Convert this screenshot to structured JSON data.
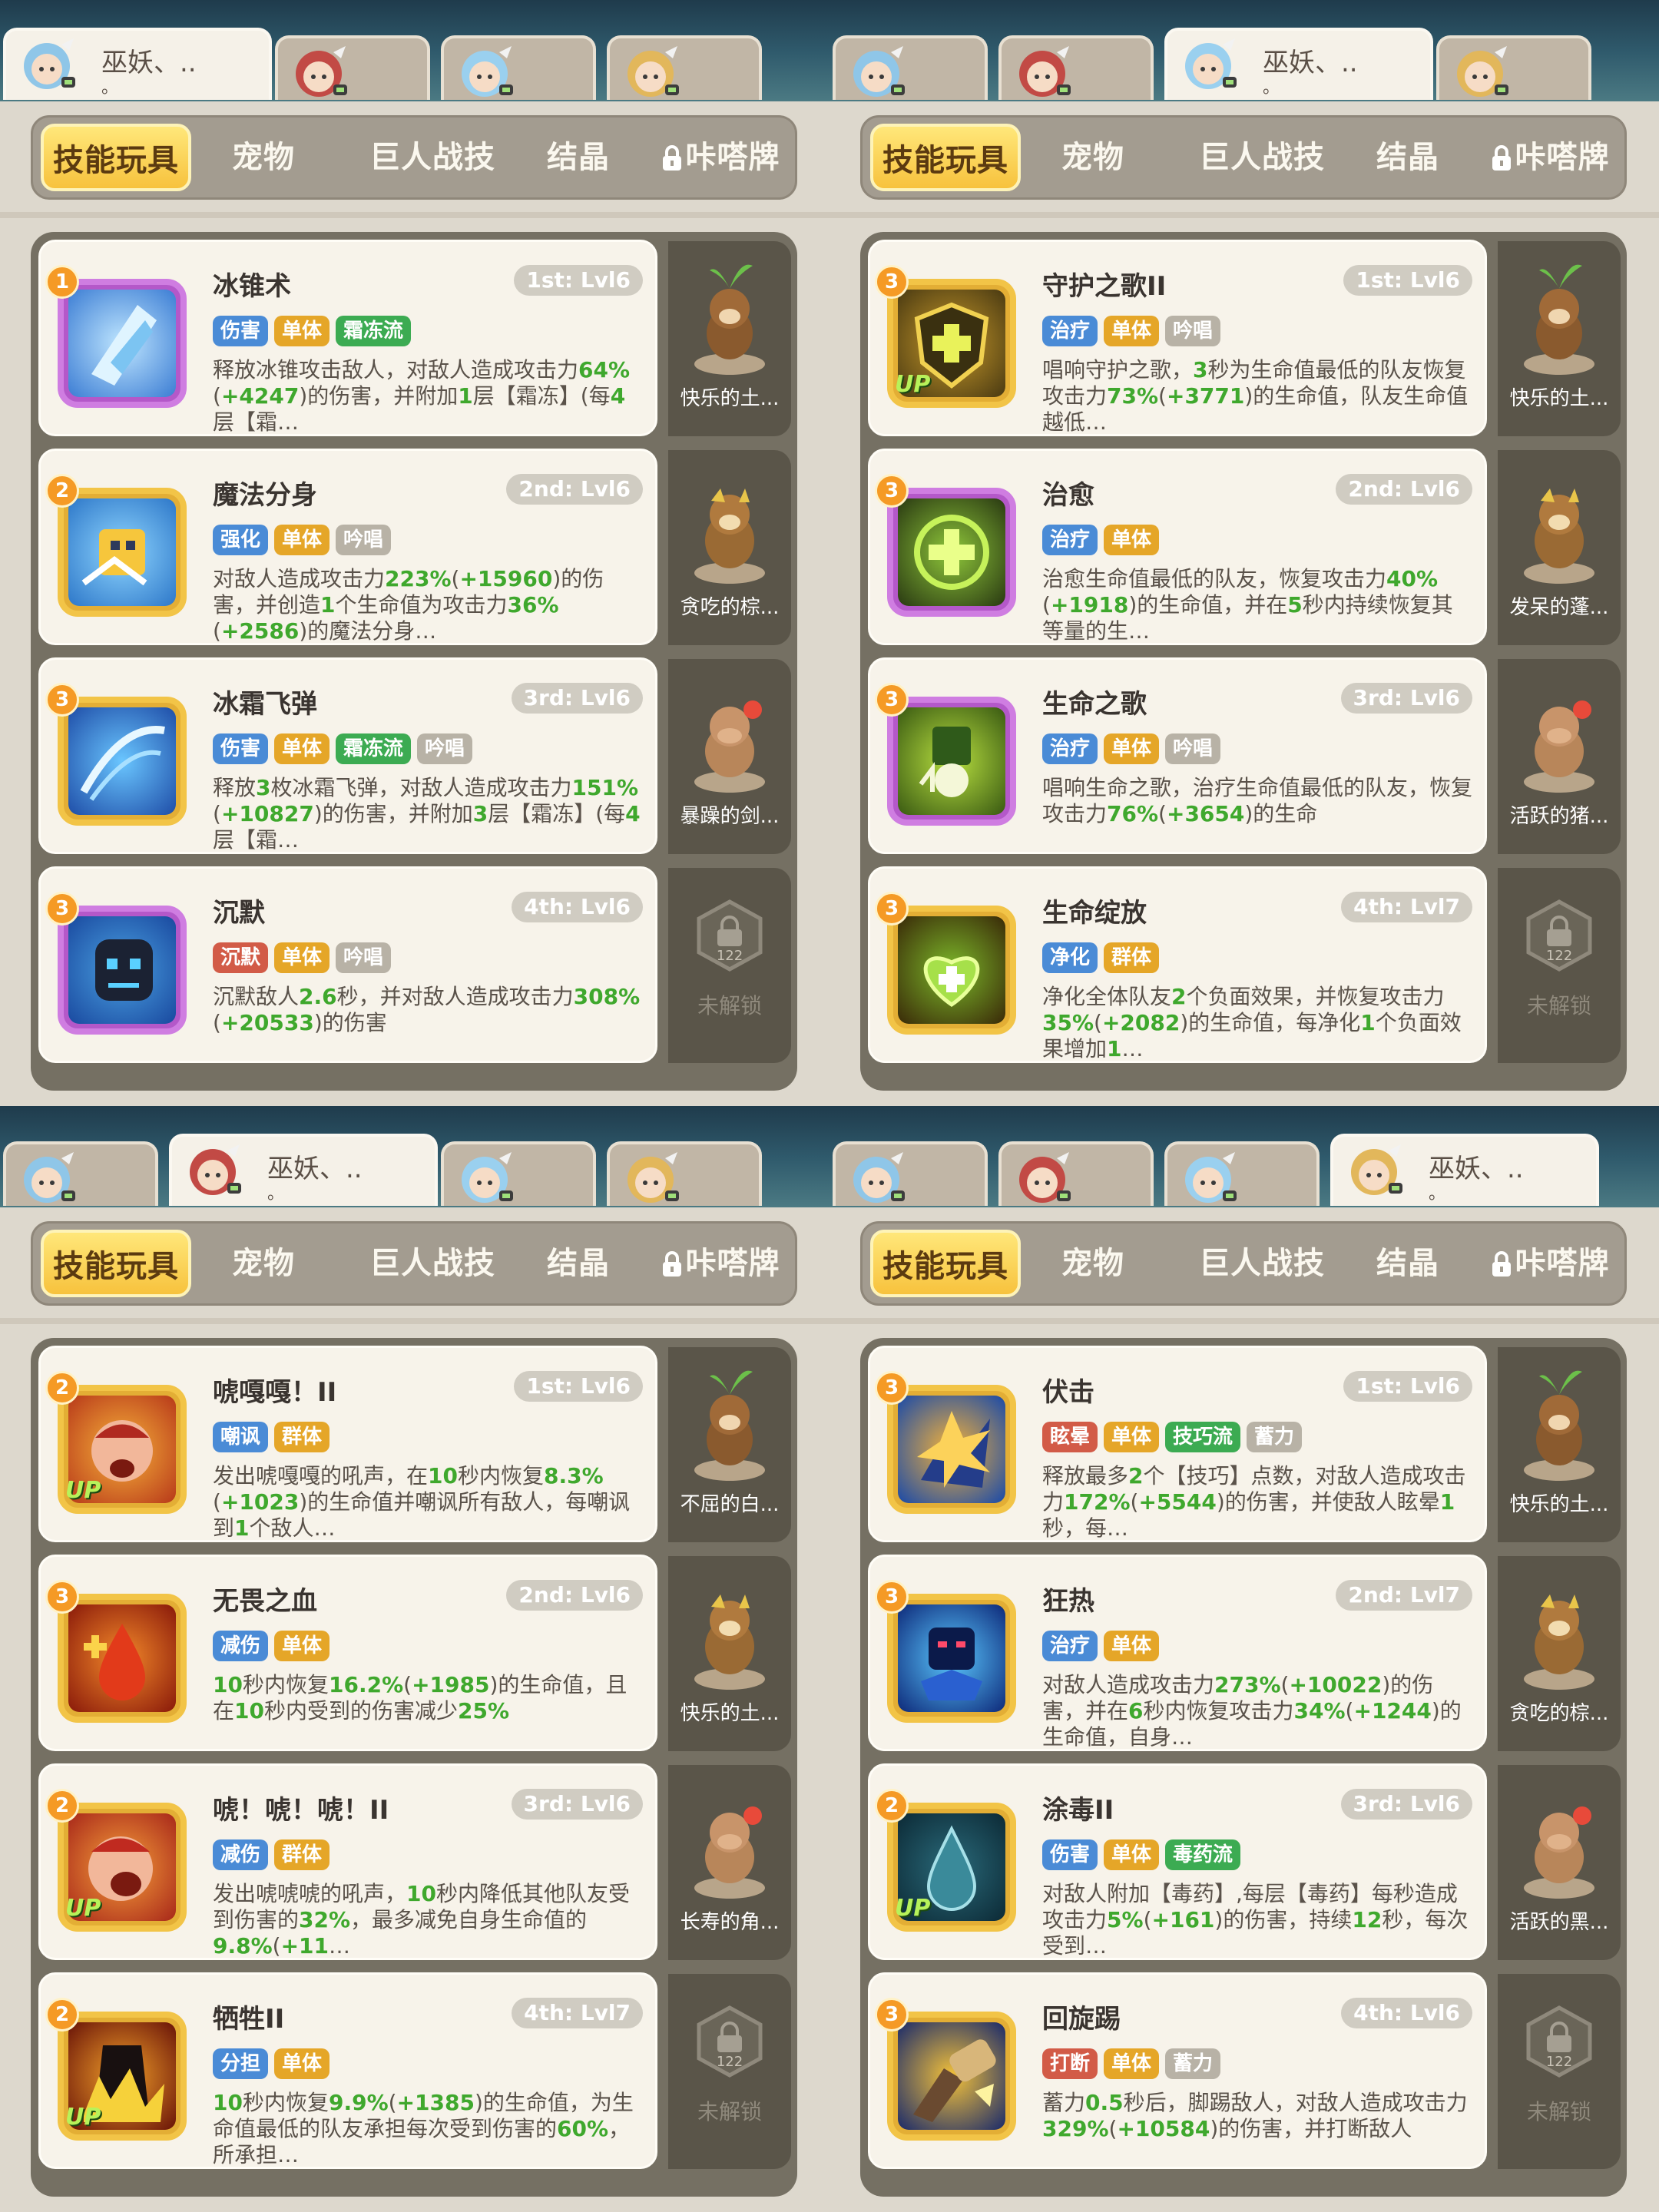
{
  "panels": [
    {
      "selected_char": 0,
      "selected_char_name": "巫妖、..",
      "selected_char_sub": "。",
      "cards": [
        {
          "name": "冰锥术",
          "level": "1st: Lvl6",
          "rank": "1",
          "frame": "purple",
          "icon": "ice-cone-icon",
          "up": false,
          "tags": [
            {
              "text": "伤害",
              "color": "#4a8bd6"
            },
            {
              "text": "单体",
              "color": "#e5a628"
            },
            {
              "text": "霜冻流",
              "color": "#3cab52"
            }
          ],
          "desc": "释放冰锥攻击敌人，对敌人造成攻击力64%(+4247)的伤害，并附加1层【霜冻】(每4层【霜…"
        },
        {
          "name": "魔法分身",
          "level": "2nd: Lvl6",
          "rank": "2",
          "frame": "gold",
          "icon": "magic-clone-icon",
          "up": false,
          "tags": [
            {
              "text": "强化",
              "color": "#4a8bd6"
            },
            {
              "text": "单体",
              "color": "#e5a628"
            },
            {
              "text": "吟唱",
              "color": "#b8b2a6"
            }
          ],
          "desc": "对敌人造成攻击力223%(+15960)的伤害，并创造1个生命值为攻击力36%(+2586)的魔法分身…"
        },
        {
          "name": "冰霜飞弹",
          "level": "3rd: Lvl6",
          "rank": "3",
          "frame": "gold",
          "icon": "frost-missile-icon",
          "up": false,
          "tags": [
            {
              "text": "伤害",
              "color": "#4a8bd6"
            },
            {
              "text": "单体",
              "color": "#e5a628"
            },
            {
              "text": "霜冻流",
              "color": "#3cab52"
            },
            {
              "text": "吟唱",
              "color": "#b8b2a6"
            }
          ],
          "desc": "释放3枚冰霜飞弹，对敌人造成攻击力151%(+10827)的伤害，并附加3层【霜冻】(每4层【霜…"
        },
        {
          "name": "沉默",
          "level": "4th: Lvl6",
          "rank": "3",
          "frame": "purple",
          "icon": "silence-icon",
          "up": false,
          "tags": [
            {
              "text": "沉默",
              "color": "#d25b47"
            },
            {
              "text": "单体",
              "color": "#e5a628"
            },
            {
              "text": "吟唱",
              "color": "#b8b2a6"
            }
          ],
          "desc": "沉默敌人2.6秒，并对敌人造成攻击力308%(+20533)的伤害"
        }
      ],
      "pets": [
        "快乐的土...",
        "贪吃的棕...",
        "暴躁的剑..."
      ]
    },
    {
      "selected_char": 2,
      "selected_char_name": "巫妖、..",
      "selected_char_sub": "。",
      "cards": [
        {
          "name": "守护之歌II",
          "level": "1st: Lvl6",
          "rank": "3",
          "frame": "gold",
          "icon": "guard-song-icon",
          "up": true,
          "tags": [
            {
              "text": "治疗",
              "color": "#4a8bd6"
            },
            {
              "text": "单体",
              "color": "#e5a628"
            },
            {
              "text": "吟唱",
              "color": "#b8b2a6"
            }
          ],
          "desc": "唱响守护之歌，3秒为生命值最低的队友恢复攻击力73%(+3771)的生命值，队友生命值越低…"
        },
        {
          "name": "治愈",
          "level": "2nd: Lvl6",
          "rank": "3",
          "frame": "purple",
          "icon": "heal-icon",
          "up": false,
          "tags": [
            {
              "text": "治疗",
              "color": "#4a8bd6"
            },
            {
              "text": "单体",
              "color": "#e5a628"
            }
          ],
          "desc": "治愈生命值最低的队友，恢复攻击力40%(+1918)的生命值，并在5秒内持续恢复其等量的生…"
        },
        {
          "name": "生命之歌",
          "level": "3rd: Lvl6",
          "rank": "3",
          "frame": "purple",
          "icon": "life-song-icon",
          "up": false,
          "tags": [
            {
              "text": "治疗",
              "color": "#4a8bd6"
            },
            {
              "text": "单体",
              "color": "#e5a628"
            },
            {
              "text": "吟唱",
              "color": "#b8b2a6"
            }
          ],
          "desc": "唱响生命之歌，治疗生命值最低的队友，恢复攻击力76%(+3654)的生命"
        },
        {
          "name": "生命绽放",
          "level": "4th: Lvl7",
          "rank": "3",
          "frame": "gold",
          "icon": "life-bloom-icon",
          "up": false,
          "tags": [
            {
              "text": "净化",
              "color": "#4a8bd6"
            },
            {
              "text": "群体",
              "color": "#e5a628"
            }
          ],
          "desc": "净化全体队友2个负面效果，并恢复攻击力35%(+2082)的生命值，每净化1个负面效果增加1…"
        }
      ],
      "pets": [
        "快乐的土...",
        "发呆的蓬...",
        "活跃的猪..."
      ]
    },
    {
      "selected_char": 1,
      "selected_char_name": "巫妖、..",
      "selected_char_sub": "。",
      "cards": [
        {
          "name": "唬嘎嘎！II",
          "level": "1st: Lvl6",
          "rank": "2",
          "frame": "gold",
          "icon": "roar-icon",
          "up": true,
          "tags": [
            {
              "text": "嘲讽",
              "color": "#4a8bd6"
            },
            {
              "text": "群体",
              "color": "#e5a628"
            }
          ],
          "desc": "发出唬嘎嘎的吼声，在10秒内恢复8.3%(+1023)的生命值并嘲讽所有敌人，每嘲讽到1个敌人…"
        },
        {
          "name": "无畏之血",
          "level": "2nd: Lvl6",
          "rank": "3",
          "frame": "gold",
          "icon": "fearless-blood-icon",
          "up": false,
          "tags": [
            {
              "text": "减伤",
              "color": "#4a8bd6"
            },
            {
              "text": "单体",
              "color": "#e5a628"
            }
          ],
          "desc": "10秒内恢复16.2%(+1985)的生命值，且在10秒内受到的伤害减少25%"
        },
        {
          "name": "唬！唬！唬！II",
          "level": "3rd: Lvl6",
          "rank": "2",
          "frame": "gold",
          "icon": "shout-icon",
          "up": true,
          "tags": [
            {
              "text": "减伤",
              "color": "#4a8bd6"
            },
            {
              "text": "群体",
              "color": "#e5a628"
            }
          ],
          "desc": "发出唬唬唬的吼声，10秒内降低其他队友受到伤害的32%，最多减免自身生命值的9.8%(+11…"
        },
        {
          "name": "牺牲II",
          "level": "4th: Lvl7",
          "rank": "2",
          "frame": "gold",
          "icon": "sacrifice-icon",
          "up": true,
          "tags": [
            {
              "text": "分担",
              "color": "#4a8bd6"
            },
            {
              "text": "单体",
              "color": "#e5a628"
            }
          ],
          "desc": "10秒内恢复9.9%(+1385)的生命值，为生命值最低的队友承担每次受到伤害的60%，所承担…"
        }
      ],
      "pets": [
        "不屈的白...",
        "快乐的土...",
        "长寿的角..."
      ]
    },
    {
      "selected_char": 3,
      "selected_char_name": "巫妖、..",
      "selected_char_sub": "。",
      "cards": [
        {
          "name": "伏击",
          "level": "1st: Lvl6",
          "rank": "3",
          "frame": "gold",
          "icon": "ambush-icon",
          "up": false,
          "tags": [
            {
              "text": "眩晕",
              "color": "#d25b47"
            },
            {
              "text": "单体",
              "color": "#e5a628"
            },
            {
              "text": "技巧流",
              "color": "#3cab52"
            },
            {
              "text": "蓄力",
              "color": "#b8b2a6"
            }
          ],
          "desc": "释放最多2个【技巧】点数，对敌人造成攻击力172%(+5544)的伤害，并使敌人眩晕1秒，每…"
        },
        {
          "name": "狂热",
          "level": "2nd: Lvl7",
          "rank": "3",
          "frame": "gold",
          "icon": "frenzy-icon",
          "up": false,
          "tags": [
            {
              "text": "治疗",
              "color": "#4a8bd6"
            },
            {
              "text": "单体",
              "color": "#e5a628"
            }
          ],
          "desc": "对敌人造成攻击力273%(+10022)的伤害，并在6秒内恢复攻击力34%(+1244)的生命值，自身…"
        },
        {
          "name": "涂毒II",
          "level": "3rd: Lvl6",
          "rank": "2",
          "frame": "gold",
          "icon": "poison-icon",
          "up": true,
          "tags": [
            {
              "text": "伤害",
              "color": "#4a8bd6"
            },
            {
              "text": "单体",
              "color": "#e5a628"
            },
            {
              "text": "毒药流",
              "color": "#3cab52"
            }
          ],
          "desc": "对敌人附加【毒药】,每层【毒药】每秒造成攻击力5%(+161)的伤害，持续12秒，每次受到…"
        },
        {
          "name": "回旋踢",
          "level": "4th: Lvl6",
          "rank": "3",
          "frame": "gold",
          "icon": "spin-kick-icon",
          "up": false,
          "tags": [
            {
              "text": "打断",
              "color": "#d25b47"
            },
            {
              "text": "单体",
              "color": "#e5a628"
            },
            {
              "text": "蓄力",
              "color": "#b8b2a6"
            }
          ],
          "desc": "蓄力0.5秒后，脚踢敌人，对敌人造成攻击力329%(+10584)的伤害，并打断敌人"
        }
      ],
      "pets": [
        "快乐的土...",
        "贪吃的棕...",
        "活跃的黑..."
      ]
    }
  ],
  "tabs": [
    "技能玩具",
    "宠物",
    "巨人战技",
    "结晶",
    "咔嗒牌"
  ],
  "tab_lock_icon": "lock-icon",
  "locked_slot": {
    "count": "122",
    "text": "未解锁",
    "icon": "lock-hex-icon"
  },
  "char_portraits": [
    "blue-hair-mage-icon",
    "red-hair-warrior-icon",
    "blue-ponytail-icon",
    "blonde-hair-icon"
  ],
  "colors": {
    "highlight_number": "#3fa82d",
    "tab_active": "#f7c23d",
    "panel_bg": "#757063"
  }
}
